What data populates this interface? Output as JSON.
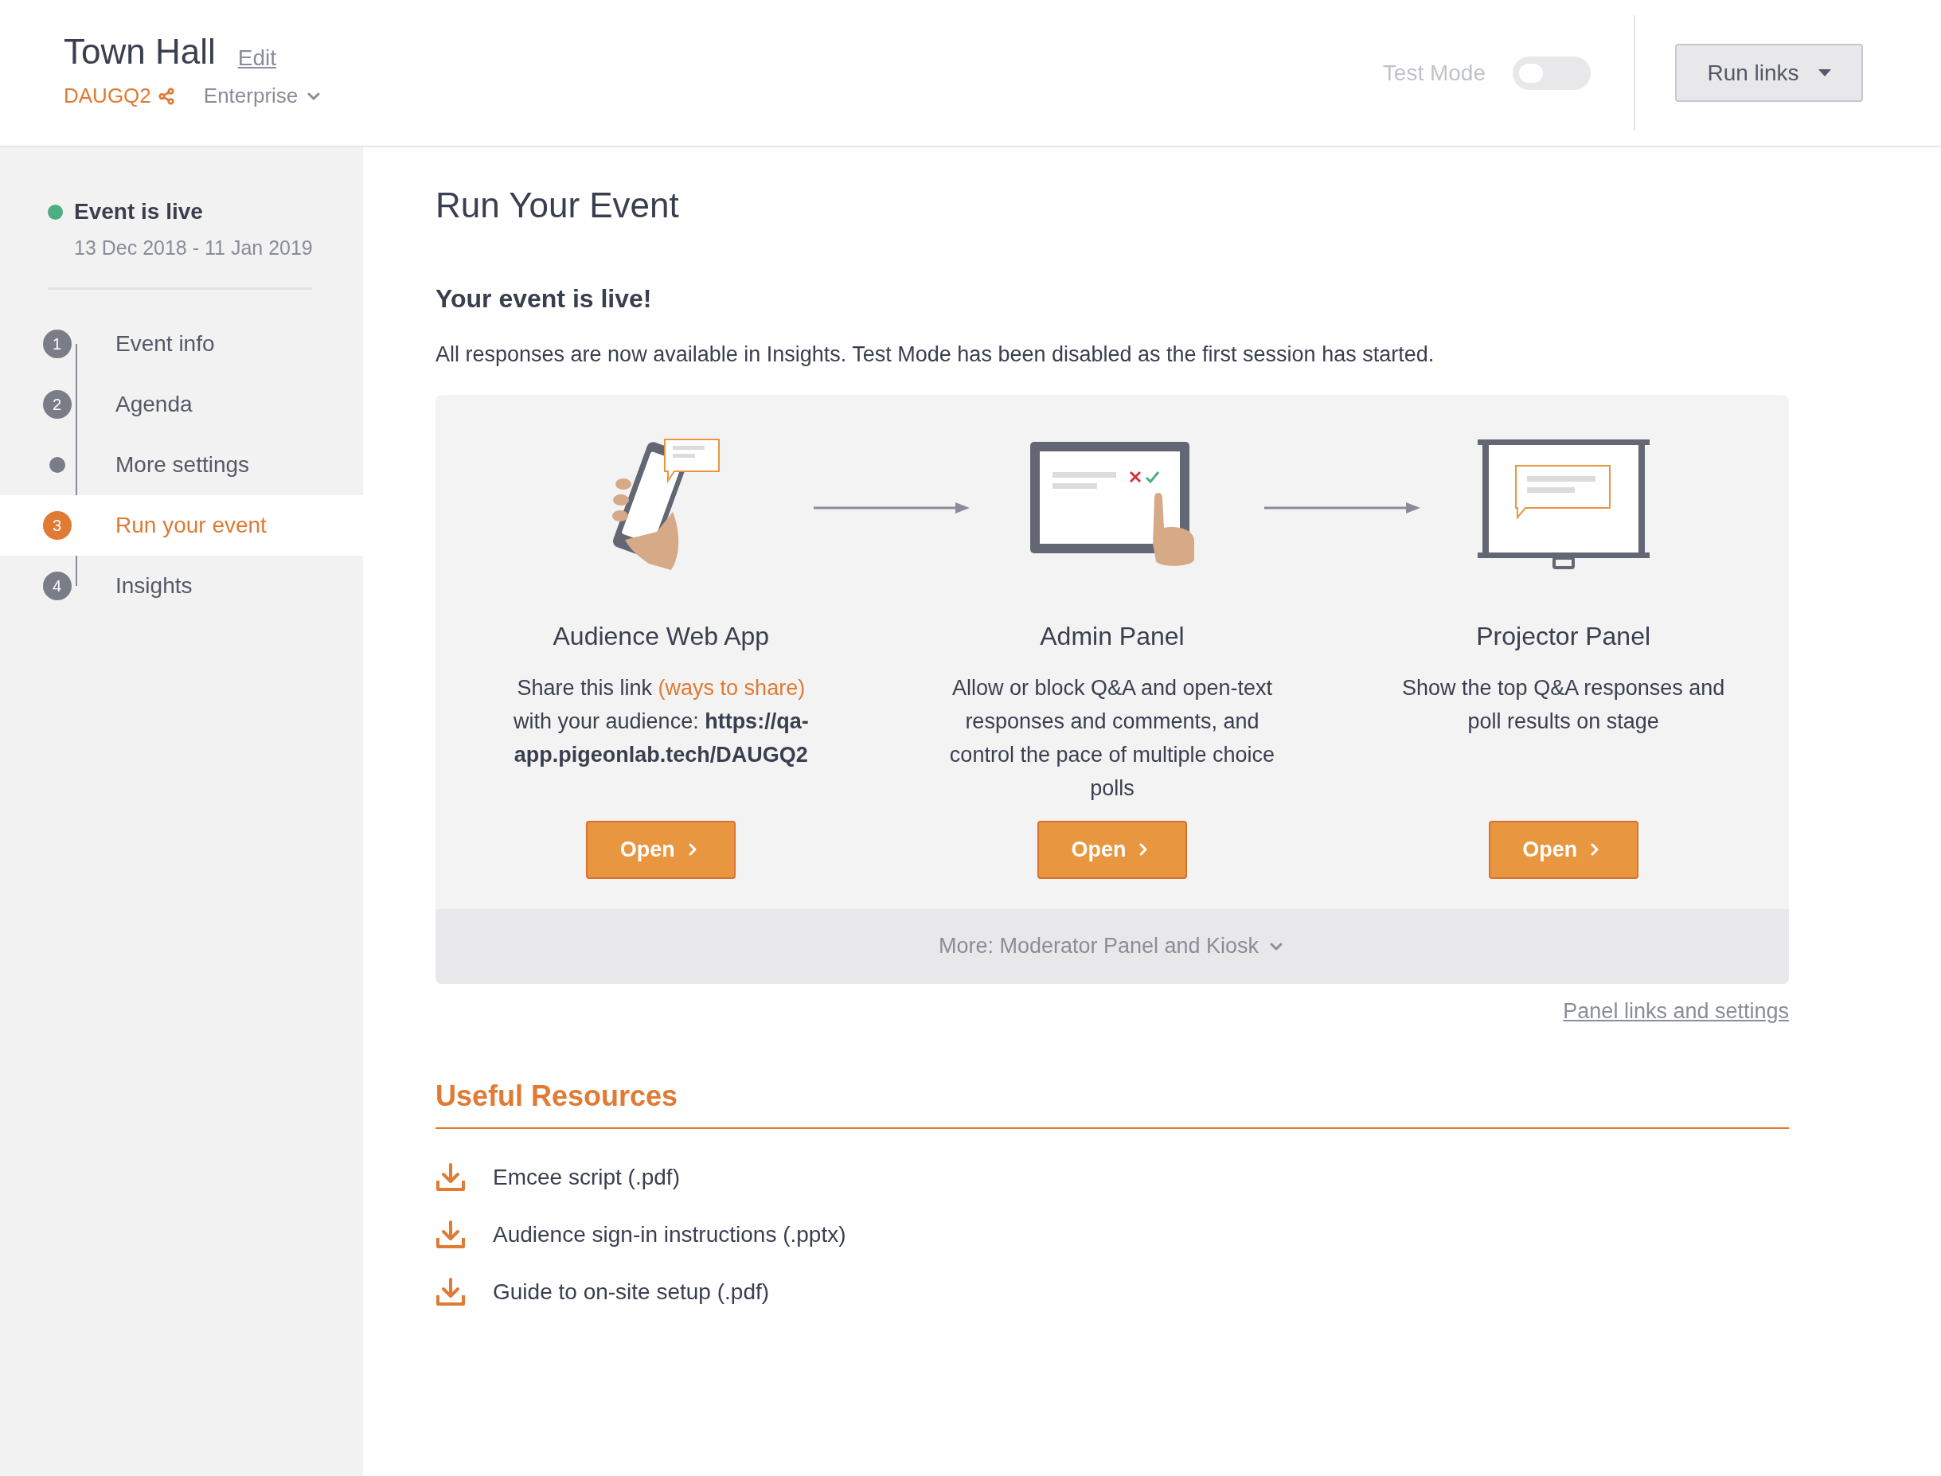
{
  "header": {
    "title": "Town Hall",
    "edit_link": "Edit",
    "code": "DAUGQ2",
    "plan": "Enterprise",
    "test_mode": {
      "label": "Test Mode",
      "on": false,
      "disabled": true
    },
    "run_links_button": "Run links"
  },
  "sidebar": {
    "status": {
      "label": "Event is live",
      "dates": "13 Dec 2018 - 11 Jan 2019",
      "color": "#4caf7f"
    },
    "steps": [
      {
        "kind": "numbered",
        "number": "1",
        "label": "Event info",
        "selected": false
      },
      {
        "kind": "numbered",
        "number": "2",
        "label": "Agenda",
        "selected": false
      },
      {
        "kind": "dot",
        "label": "More settings",
        "selected": false
      },
      {
        "kind": "numbered",
        "number": "3",
        "label": "Run your event",
        "selected": true
      },
      {
        "kind": "numbered",
        "number": "4",
        "label": "Insights",
        "selected": false
      }
    ]
  },
  "main": {
    "title": "Run Your Event",
    "subtitle": "Your event is live!",
    "description": "All responses are now available in Insights. Test Mode has been disabled as the first session has started.",
    "panels": [
      {
        "kind": "phone",
        "title": "Audience Web App",
        "description_before": "Share this link",
        "link": "(ways to share)",
        "description_after": "with your audience: **https://qa-app.pigeonlab.tech/DAUGQ2**",
        "button": "Open"
      },
      {
        "kind": "tablet",
        "title": "Admin Panel",
        "description_before": "Allow or block Q&A and open-text responses and comments, and control the pace of multiple choice polls",
        "button": "Open"
      },
      {
        "kind": "projector",
        "title": "Projector Panel",
        "description_before": "Show the top Q&A responses and poll results on stage",
        "button": "Open"
      }
    ],
    "more_toggle": "More: Moderator Panel and Kiosk",
    "settings_link": "Panel links and settings",
    "resources": {
      "title": "Useful Resources",
      "items": [
        "Emcee script (.pdf)",
        "Audience sign-in instructions (.pptx)",
        "Guide to on-site setup (.pdf)"
      ]
    }
  }
}
